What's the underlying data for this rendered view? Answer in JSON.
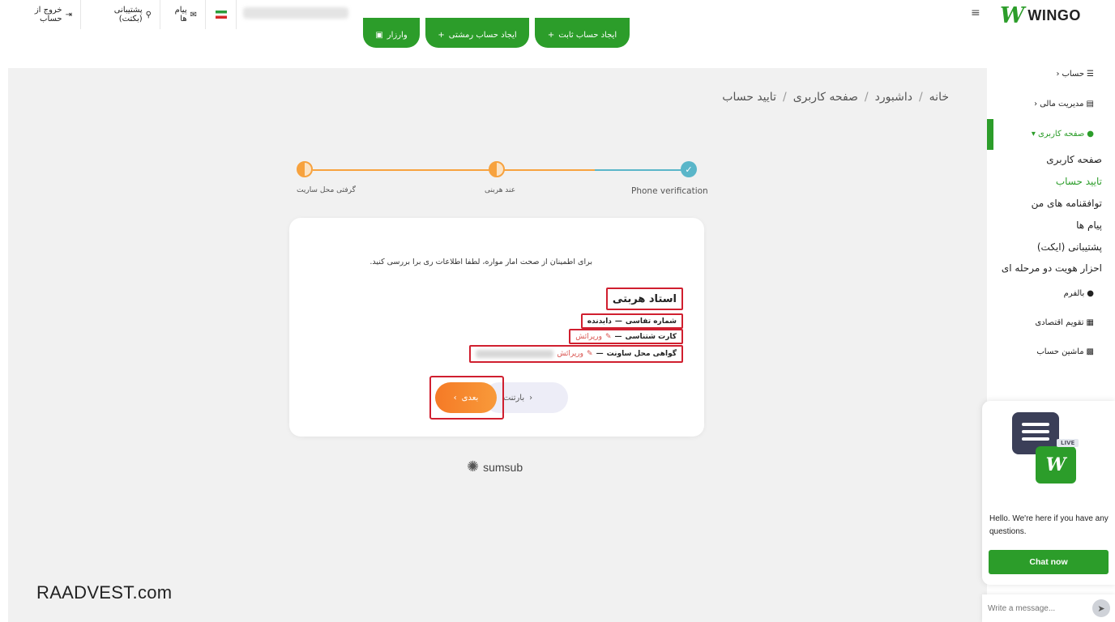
{
  "brand": {
    "name": "WINGO",
    "mark": "W",
    "color": "#2c9d2a"
  },
  "topbar": {
    "logout": {
      "label": "خروج از حساب",
      "icon": "logout-icon"
    },
    "support": {
      "label": "پشتیبانی (بکتت)",
      "icon": "support-icon"
    },
    "messages": {
      "label": "پیام ها",
      "icon": "envelope-icon"
    },
    "flag": "iran-flag-icon",
    "buttons": [
      {
        "label": "وارزار",
        "icon": "deposit-icon"
      },
      {
        "label": "ایجاد حساب رمشتی",
        "icon": "plus-icon"
      },
      {
        "label": "ایجاد حساب ثابت",
        "icon": "plus-icon"
      }
    ]
  },
  "breadcrumb": [
    "خانه",
    "داشبورد",
    "صفحه کاربری",
    "تایید حساب"
  ],
  "stepper": {
    "steps": [
      {
        "label": "Phone verification",
        "state": "done"
      },
      {
        "label": "عند هربنی",
        "state": "in-progress"
      },
      {
        "label": "گرفتی محل ساریت",
        "state": "in-progress"
      }
    ],
    "colors": {
      "done": "#5ab6c9",
      "progress": "#f7a23e"
    }
  },
  "card": {
    "intro": "برای اطمینان از صحت امار مواره، لطفا اطلاعات ری برا بررسی کنید.",
    "doc_title": "استاد هربتی",
    "rows": [
      {
        "label": "شماره تفاسی",
        "value": "دابدنده",
        "edit": ""
      },
      {
        "label": "کارت شتناسی",
        "value": "",
        "edit": "ورپرائش"
      },
      {
        "label": "گواهی محل ساونت",
        "value": "",
        "edit": "ورپرائش"
      }
    ],
    "prev_label": "بارتنت",
    "next_label": "بعدی",
    "highlight_color": "#d01f2f"
  },
  "sumsub": "sumsub",
  "watermark": "RAADVEST.com",
  "sidebar": {
    "items": [
      {
        "label": "حساب",
        "icon": "list-icon",
        "chevron": "chevron-left-icon"
      },
      {
        "label": "مدیریت مالی",
        "icon": "wallet-icon",
        "chevron": "chevron-left-icon"
      },
      {
        "label": "صفحه کاربری",
        "icon": "user-icon",
        "chevron": "chevron-down-icon"
      },
      {
        "label": "بالفرم",
        "icon": "user-icon"
      },
      {
        "label": "تقویم اقتصادی",
        "icon": "calendar-icon"
      },
      {
        "label": "ماشین حساب",
        "icon": "calculator-icon"
      }
    ],
    "subitems": [
      {
        "label": "صفحه کاربری"
      },
      {
        "label": "تایید حساب"
      },
      {
        "label": "توافقنامه های من"
      },
      {
        "label": "پیام ها"
      },
      {
        "label": "پشتیبانی (ایکت)"
      },
      {
        "label": "احزار هویت دو مرحله ای"
      }
    ]
  },
  "chat": {
    "live": "LIVE",
    "text": "Hello. We're here if you have any questions.",
    "button": "Chat now",
    "placeholder": "Write a message..."
  }
}
